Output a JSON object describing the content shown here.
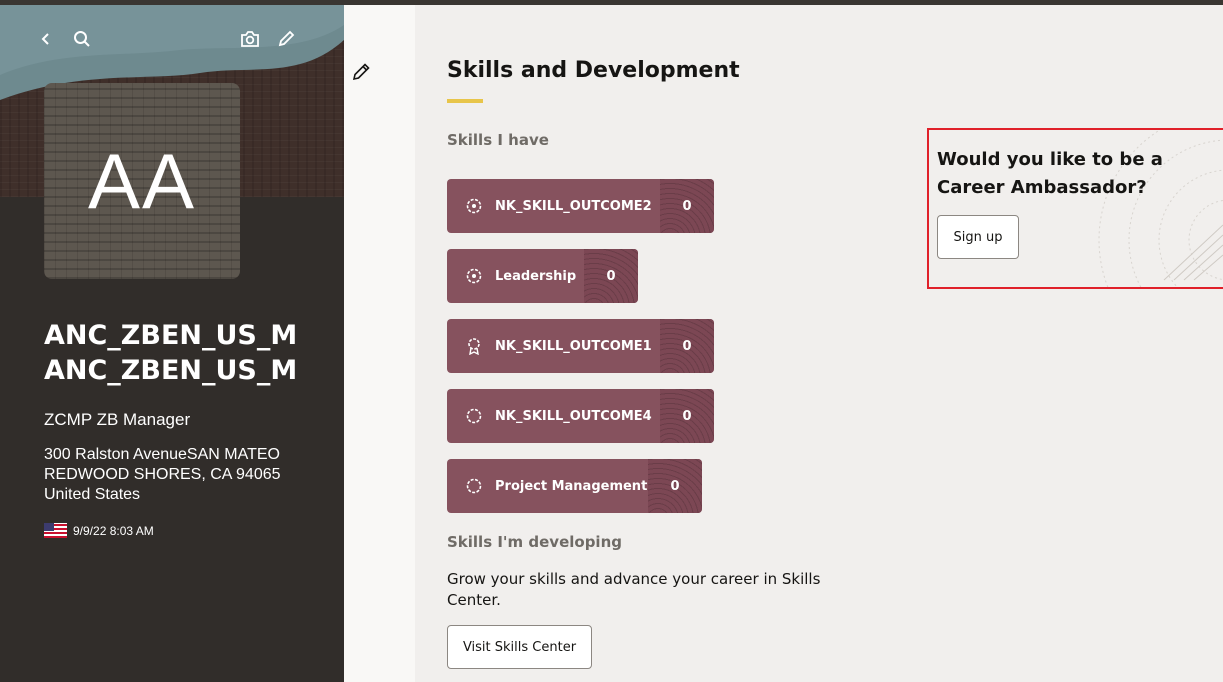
{
  "profile": {
    "initials": "AA",
    "name_line1": "ANC_ZBEN_US_MA",
    "name_line2": "ANC_ZBEN_US_MA",
    "title": "ZCMP ZB Manager",
    "address_line1": "300 Ralston AvenueSAN MATEO",
    "address_line2": "REDWOOD SHORES, CA 94065",
    "address_line3": "United States",
    "local_time": "9/9/22 8:03 AM",
    "icons": {
      "back": "chevron-left-icon",
      "search": "search-icon",
      "camera": "camera-icon",
      "edit": "pencil-icon"
    }
  },
  "main": {
    "title": "Skills and Development",
    "skills_heading": "Skills I have",
    "skills": [
      {
        "name": "NK_SKILL_OUTCOME2",
        "count": "0"
      },
      {
        "name": "Leadership",
        "count": "0"
      },
      {
        "name": "NK_SKILL_OUTCOME1",
        "count": "0"
      },
      {
        "name": "NK_SKILL_OUTCOME4",
        "count": "0"
      },
      {
        "name": "Project Management",
        "count": "0"
      }
    ],
    "developing_heading": "Skills I'm developing",
    "developing_text": "Grow your skills and advance your career in Skills Center.",
    "visit_button": "Visit Skills Center"
  },
  "ambassador": {
    "question": "Would you like to be a Career Ambassador?",
    "signup_button": "Sign up"
  },
  "colors": {
    "profile_bg": "#312d2a",
    "skill_chip": "#86525e",
    "accent_underline": "#e8c54a",
    "highlight_border": "#e0202a"
  }
}
